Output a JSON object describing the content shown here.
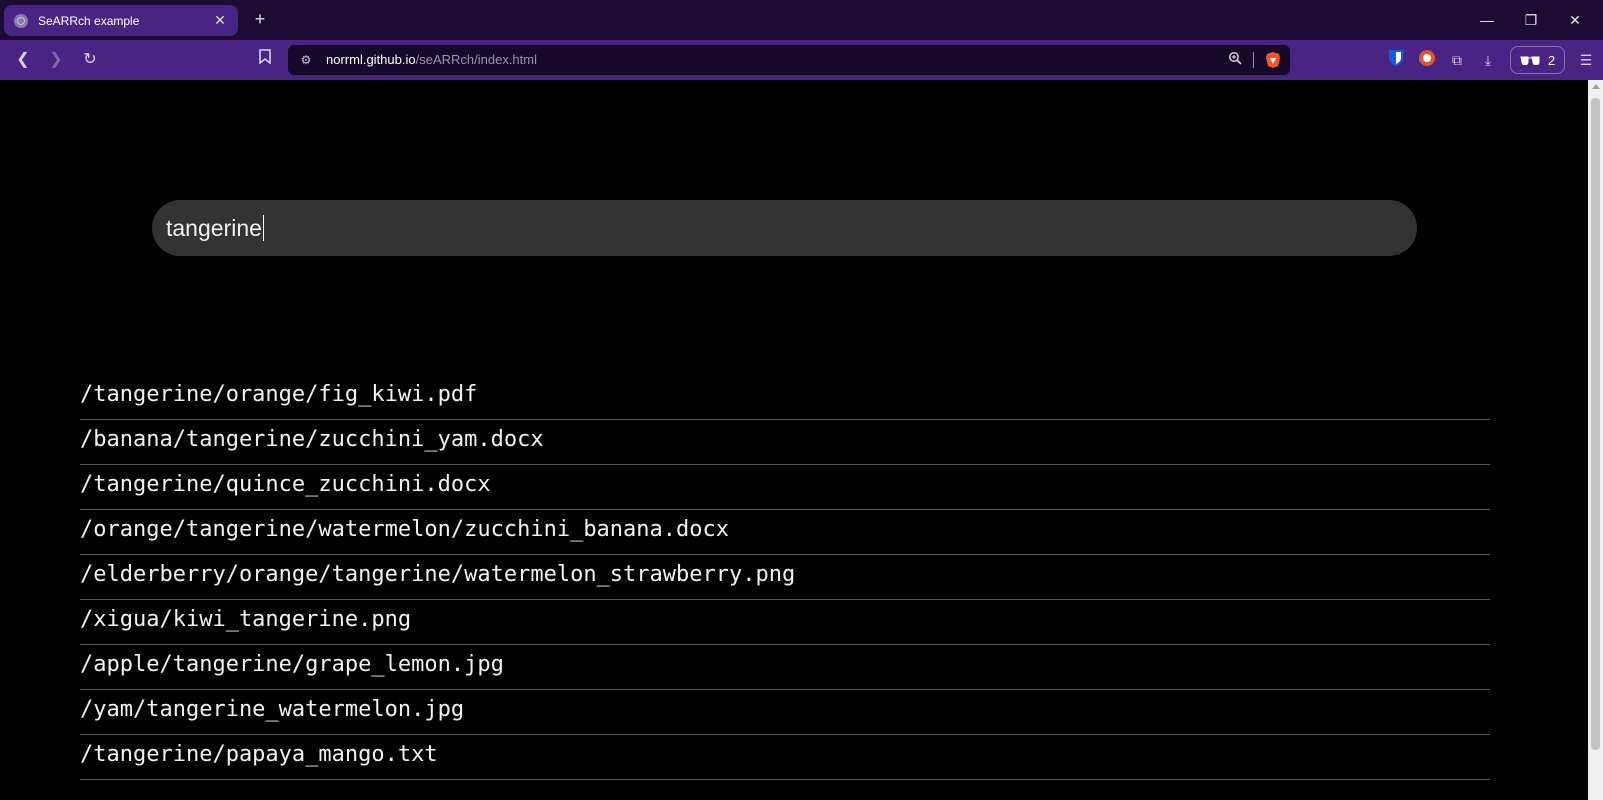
{
  "browser": {
    "tab": {
      "title": "SeARRch example",
      "close_icon": "close-icon"
    },
    "new_tab_icon": "plus-icon",
    "window_controls": [
      "minimize-icon",
      "restore-icon",
      "close-icon"
    ],
    "address": {
      "host": "norrml.github.io",
      "path": "/seARRch/index.html"
    },
    "profile_count": "2",
    "colors": {
      "titlebar": "#1c0c33",
      "toolbar": "#4a2485",
      "urlbar": "#160a2a"
    }
  },
  "search": {
    "value": "tangerine"
  },
  "results": [
    "/tangerine/orange/fig_kiwi.pdf",
    "/banana/tangerine/zucchini_yam.docx",
    "/tangerine/quince_zucchini.docx",
    "/orange/tangerine/watermelon/zucchini_banana.docx",
    "/elderberry/orange/tangerine/watermelon_strawberry.png",
    "/xigua/kiwi_tangerine.png",
    "/apple/tangerine/grape_lemon.jpg",
    "/yam/tangerine_watermelon.jpg",
    "/tangerine/papaya_mango.txt"
  ]
}
